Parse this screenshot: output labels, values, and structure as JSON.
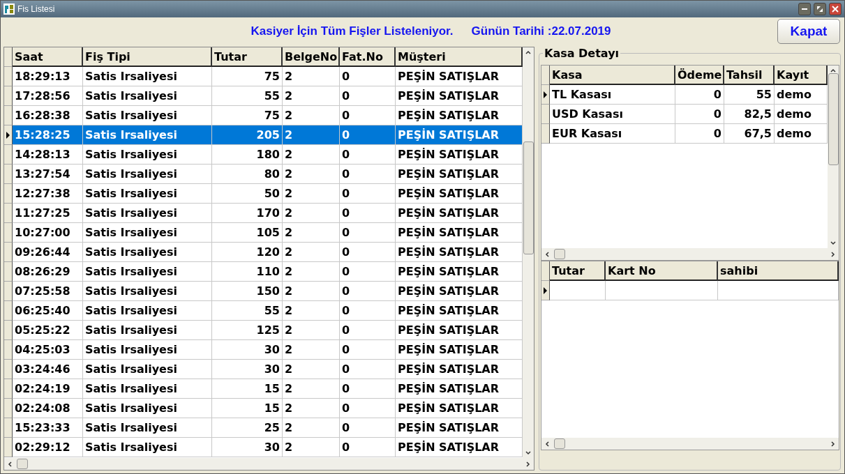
{
  "window": {
    "title": "Fis Listesi"
  },
  "header": {
    "title": "Kasiyer İçin Tüm Fişler Listeleniyor.",
    "date": "Günün Tarihi :22.07.2019",
    "close_button": "Kapat"
  },
  "receipts": {
    "columns": [
      "Saat",
      "Fiş Tipi",
      "Tutar",
      "BelgeNo",
      "Fat.No",
      "Müşteri"
    ],
    "rows": [
      {
        "cells": [
          "18:29:13",
          "Satis Irsaliyesi",
          "75",
          "2",
          "0",
          "PEŞİN SATIŞLAR"
        ],
        "selected": false
      },
      {
        "cells": [
          "17:28:56",
          "Satis Irsaliyesi",
          "55",
          "2",
          "0",
          "PEŞİN SATIŞLAR"
        ],
        "selected": false
      },
      {
        "cells": [
          "16:28:38",
          "Satis Irsaliyesi",
          "75",
          "2",
          "0",
          "PEŞİN SATIŞLAR"
        ],
        "selected": false
      },
      {
        "cells": [
          "15:28:25",
          "Satis Irsaliyesi",
          "205",
          "2",
          "0",
          "PEŞİN SATIŞLAR"
        ],
        "selected": true
      },
      {
        "cells": [
          "14:28:13",
          "Satis Irsaliyesi",
          "180",
          "2",
          "0",
          "PEŞİN SATIŞLAR"
        ],
        "selected": false
      },
      {
        "cells": [
          "13:27:54",
          "Satis Irsaliyesi",
          "80",
          "2",
          "0",
          "PEŞİN SATIŞLAR"
        ],
        "selected": false
      },
      {
        "cells": [
          "12:27:38",
          "Satis Irsaliyesi",
          "50",
          "2",
          "0",
          "PEŞİN SATIŞLAR"
        ],
        "selected": false
      },
      {
        "cells": [
          "11:27:25",
          "Satis Irsaliyesi",
          "170",
          "2",
          "0",
          "PEŞİN SATIŞLAR"
        ],
        "selected": false
      },
      {
        "cells": [
          "10:27:00",
          "Satis Irsaliyesi",
          "105",
          "2",
          "0",
          "PEŞİN SATIŞLAR"
        ],
        "selected": false
      },
      {
        "cells": [
          "09:26:44",
          "Satis Irsaliyesi",
          "120",
          "2",
          "0",
          "PEŞİN SATIŞLAR"
        ],
        "selected": false
      },
      {
        "cells": [
          "08:26:29",
          "Satis Irsaliyesi",
          "110",
          "2",
          "0",
          "PEŞİN SATIŞLAR"
        ],
        "selected": false
      },
      {
        "cells": [
          "07:25:58",
          "Satis Irsaliyesi",
          "150",
          "2",
          "0",
          "PEŞİN SATIŞLAR"
        ],
        "selected": false
      },
      {
        "cells": [
          "06:25:40",
          "Satis Irsaliyesi",
          "55",
          "2",
          "0",
          "PEŞİN SATIŞLAR"
        ],
        "selected": false
      },
      {
        "cells": [
          "05:25:22",
          "Satis Irsaliyesi",
          "125",
          "2",
          "0",
          "PEŞİN SATIŞLAR"
        ],
        "selected": false
      },
      {
        "cells": [
          "04:25:03",
          "Satis Irsaliyesi",
          "30",
          "2",
          "0",
          "PEŞİN SATIŞLAR"
        ],
        "selected": false
      },
      {
        "cells": [
          "03:24:46",
          "Satis Irsaliyesi",
          "30",
          "2",
          "0",
          "PEŞİN SATIŞLAR"
        ],
        "selected": false
      },
      {
        "cells": [
          "02:24:19",
          "Satis Irsaliyesi",
          "15",
          "2",
          "0",
          "PEŞİN SATIŞLAR"
        ],
        "selected": false
      },
      {
        "cells": [
          "02:24:08",
          "Satis Irsaliyesi",
          "15",
          "2",
          "0",
          "PEŞİN SATIŞLAR"
        ],
        "selected": false
      },
      {
        "cells": [
          "15:23:33",
          "Satis Irsaliyesi",
          "25",
          "2",
          "0",
          "PEŞİN SATIŞLAR"
        ],
        "selected": false
      },
      {
        "cells": [
          "02:29:12",
          "Satis Irsaliyesi",
          "30",
          "2",
          "0",
          "PEŞİN SATIŞLAR"
        ],
        "selected": false
      }
    ]
  },
  "cash_detail": {
    "title": "Kasa Detayı",
    "columns": [
      "Kasa",
      "Ödeme",
      "Tahsil",
      "Kayıt"
    ],
    "rows": [
      {
        "cells": [
          "TL Kasası",
          "0",
          "55",
          "demo"
        ],
        "current": true
      },
      {
        "cells": [
          "USD Kasası",
          "0",
          "82,5",
          "demo"
        ],
        "current": false
      },
      {
        "cells": [
          "EUR Kasası",
          "0",
          "67,5",
          "demo"
        ],
        "current": false
      }
    ]
  },
  "card_payments": {
    "columns": [
      "Tutar",
      "Kart No",
      "sahibi"
    ],
    "rows": [
      {
        "current": true
      }
    ]
  }
}
